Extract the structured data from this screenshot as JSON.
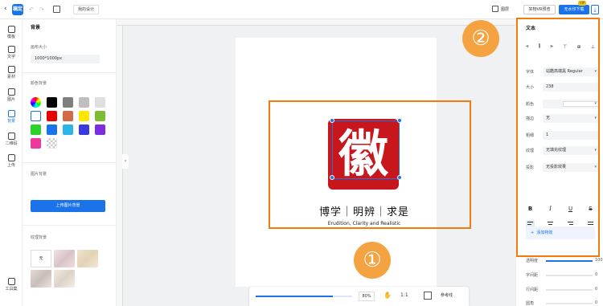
{
  "topbar": {
    "back_icon": "chevron-left-icon",
    "logo_text": "稿定",
    "undo_icon": "undo-icon",
    "redo_icon": "redo-icon",
    "save_icon": "save-icon",
    "design_name": "我的设计",
    "theme_label": "图层",
    "preview_label": "实物VR预览",
    "download_label": "无水印下载",
    "vip_badge": "VIP",
    "download_icon": "download-icon",
    "accent_color": "#1a73e8"
  },
  "rail": {
    "items": [
      {
        "label": "模板",
        "icon": "template-icon"
      },
      {
        "label": "文字",
        "icon": "text-icon"
      },
      {
        "label": "素材",
        "icon": "material-icon"
      },
      {
        "label": "图片",
        "icon": "image-icon"
      },
      {
        "label": "背景",
        "icon": "background-icon"
      },
      {
        "label": "二维码",
        "icon": "qrcode-icon"
      },
      {
        "label": "上传",
        "icon": "upload-icon"
      },
      {
        "label": "工具集",
        "icon": "toolkit-icon"
      }
    ],
    "active": "背景"
  },
  "panel": {
    "title": "背景",
    "size_label": "画布大小",
    "size_value": "1000*1000px",
    "color_label": "颜色背景",
    "swatches": [
      "#000000",
      "#7f7f7f",
      "#bfbfbf",
      "#e0e0e0",
      "#ffffff",
      "#e60000",
      "#d06a4a",
      "#ffe600",
      "#7dbd34",
      "#2ad32a",
      "#1a73e8",
      "#2bb5e8",
      "#3a3adf",
      "#7a2ee0",
      "#f0389c"
    ],
    "image_bg_label": "图片背景",
    "upload_label": "上传图片背景",
    "texture_label": "纹理背景",
    "texture_none": "无"
  },
  "canvas": {
    "seal_char": "徽",
    "motto": "博学｜明辨｜求是",
    "motto_en": "Erudition, Clarity and Realistic",
    "callout_1": "①",
    "callout_2": "②",
    "highlight_color": "#f07c10",
    "seal_color": "#c8161d",
    "collapse_icon": "chevron-left-icon"
  },
  "zoombar": {
    "zoom_value": "80%",
    "zoom_level": 0.8,
    "hand_icon": "hand-icon",
    "ratio_label": "1:1",
    "fit_icon": "fit-screen-icon",
    "ref_label": "参考线"
  },
  "rpanel": {
    "title": "文本",
    "align_icons": [
      "align-left-icon",
      "align-hcenter-icon",
      "align-right-icon",
      "align-top-icon",
      "align-vcenter-icon",
      "align-bottom-icon"
    ],
    "font_label": "字体",
    "font_value": "站酷高端黑 Regular",
    "size_label": "大小",
    "size_value": "238",
    "color_label": "颜色",
    "stroke_label": "描边",
    "stroke_value": "无",
    "opacity_label": "粗细",
    "opacity_value": "1",
    "texture_label": "纹理",
    "texture_value": "无填充纹理",
    "shadow_label": "投影",
    "shadow_value": "无投影效果",
    "style_buttons": [
      "B",
      "I",
      "U",
      "S"
    ],
    "add_effect": "添加特效",
    "sliders": [
      {
        "label": "透明度",
        "value": "100",
        "level": 1.0
      },
      {
        "label": "字间距",
        "value": "0",
        "level": 0.0
      },
      {
        "label": "行间距",
        "value": "0",
        "level": 0.0
      },
      {
        "label": "圆角",
        "value": "0",
        "level": 0.0
      }
    ]
  }
}
